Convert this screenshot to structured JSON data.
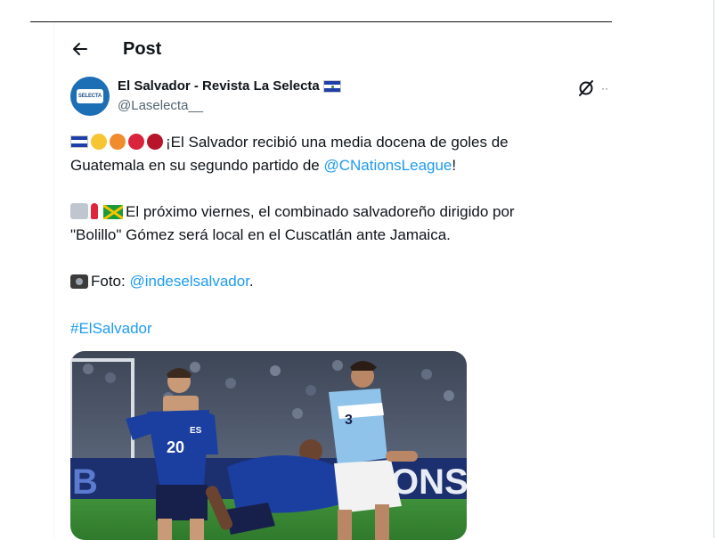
{
  "header": {
    "title": "Post"
  },
  "author": {
    "name": "El Salvador - Revista La Selecta",
    "handle": "@Laselecta__",
    "avatar_text": "SELECTA"
  },
  "icons": [
    "back-arrow-icon",
    "grok-icon",
    "more-icon",
    "el-salvador-flag-icon"
  ],
  "tweet": {
    "line1": "¡El Salvador recibió una media docena de goles de",
    "line2_text": "Guatemala en su segundo partido de ",
    "line2_link": "@CNationsLeague",
    "line2_end": "!",
    "line3": "El próximo viernes, el combinado salvadoreño dirigido por",
    "line4": "\"Bolillo\" Gómez será local en el Cuscatlán ante Jamaica.",
    "photo_prefix": "Foto: ",
    "photo_link": "@indeselsalvador",
    "photo_end": ".",
    "hashtag": "#ElSalvador"
  },
  "media": {
    "player1_number": "20",
    "player1_badge": "ES",
    "player3_number": "3",
    "board_text": "ONS",
    "board_text_left": "B"
  },
  "colors": {
    "link": "#1d9bf0",
    "secondary_text": "#536471",
    "salvador_blue": "#1b3fa0",
    "guatemala_light_blue": "#8fc3ea"
  }
}
